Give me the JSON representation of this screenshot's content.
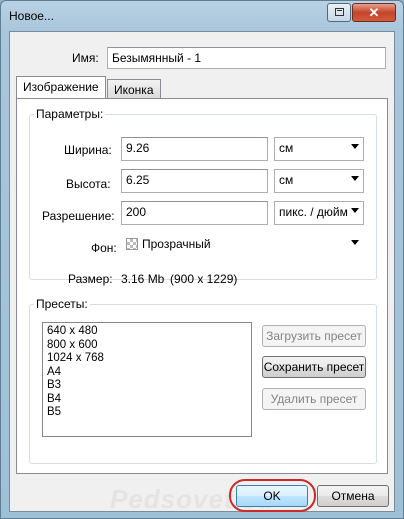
{
  "window": {
    "title": "Новое..."
  },
  "name_field": {
    "label": "Имя:",
    "value": "Безымянный - 1"
  },
  "tabs": [
    {
      "label": "Изображение",
      "active": true
    },
    {
      "label": "Иконка",
      "active": false
    }
  ],
  "params": {
    "group_title": "Параметры:",
    "width": {
      "label": "Ширина:",
      "value": "9.26",
      "unit": "см"
    },
    "height": {
      "label": "Высота:",
      "value": "6.25",
      "unit": "см"
    },
    "resolution": {
      "label": "Разрешение:",
      "value": "200",
      "unit": "пикс. / дюйм"
    },
    "background": {
      "label": "Фон:",
      "value": "Прозрачный"
    },
    "size": {
      "label": "Размер:",
      "value": "3.16 Mb",
      "dims": "(900 x 1229)"
    }
  },
  "presets": {
    "group_title": "Пресеты:",
    "items": [
      "640 x 480",
      "800 x 600",
      "1024 x 768",
      "A4",
      "B3",
      "B4",
      "B5"
    ],
    "load_button": "Загрузить пресет",
    "save_button": "Сохранить пресет",
    "delete_button": "Удалить пресет"
  },
  "footer": {
    "ok": "OK",
    "cancel": "Отмена"
  },
  "watermark": "Pedsovet.su",
  "colors": {
    "highlight": "#d02727",
    "titlebar": "#a9c6db"
  }
}
